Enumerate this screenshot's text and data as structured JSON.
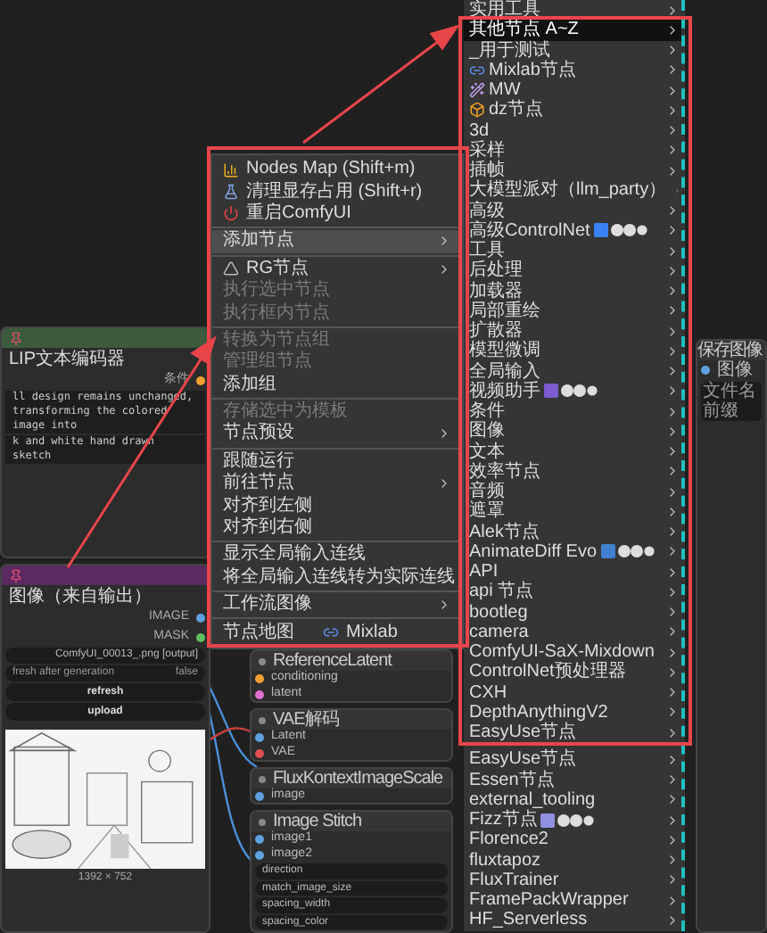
{
  "canvas_nodes": [
    {
      "color": "#3d5a3d",
      "pinned": true,
      "title": "LIP文本编码器",
      "rows": [
        {
          "kind": "output",
          "label": "条件",
          "color": "#f0a030"
        },
        {
          "kind": "text",
          "label": "ll design remains unchanged, transforming the colored image into"
        },
        {
          "kind": "text",
          "label": "k and white hand drawn sketch"
        }
      ]
    },
    {
      "color": "#5a2a60",
      "pinned": true,
      "title": "图像（来自输出）",
      "rows": [
        {
          "kind": "output",
          "label": "IMAGE",
          "color": "#60a0e0"
        },
        {
          "kind": "output",
          "label": "MASK",
          "color": "#60c060"
        },
        {
          "kind": "widget",
          "label": "",
          "value": "ComfyUI_00013_.png [output]"
        },
        {
          "kind": "toggle",
          "label": "fresh after generation",
          "value": "false"
        },
        {
          "kind": "button",
          "label": "refresh"
        },
        {
          "kind": "button",
          "label": "upload"
        },
        {
          "kind": "picture"
        },
        {
          "kind": "caption",
          "label": "1392 × 752"
        }
      ]
    },
    {
      "color": "#353535",
      "pinned": false,
      "title": "ReferenceLatent",
      "rows": [
        {
          "kind": "input",
          "label": "conditioning",
          "color": "#f0a030"
        },
        {
          "kind": "input",
          "label": "latent",
          "color": "#e070d0"
        }
      ]
    },
    {
      "color": "#353535",
      "pinned": false,
      "title": "VAE解码",
      "rows": [
        {
          "kind": "input",
          "label": "Latent",
          "color": "#60a0e0"
        },
        {
          "kind": "input",
          "label": "VAE",
          "color": "#e05050"
        }
      ]
    },
    {
      "color": "#353535",
      "pinned": false,
      "title": "FluxKontextImageScale",
      "rows": [
        {
          "kind": "input",
          "label": "image",
          "color": "#60a0e0"
        }
      ]
    },
    {
      "color": "#353535",
      "pinned": false,
      "title": "Image Stitch",
      "rows": [
        {
          "kind": "input",
          "label": "image1",
          "color": "#60a0e0"
        },
        {
          "kind": "input",
          "label": "image2",
          "color": "#60a0e0"
        },
        {
          "kind": "widget",
          "label": "direction",
          "value": ""
        },
        {
          "kind": "widget",
          "label": "match_image_size",
          "value": ""
        },
        {
          "kind": "widget",
          "label": "spacing_width",
          "value": ""
        },
        {
          "kind": "widget",
          "label": "spacing_color",
          "value": ""
        }
      ]
    },
    {
      "color": "#353535",
      "pinned": false,
      "title": "保存图像",
      "rows": [
        {
          "kind": "input",
          "label": "图像",
          "color": "#60a0e0"
        },
        {
          "kind": "field",
          "label": "文件名前缀"
        }
      ]
    }
  ],
  "context_menu": {
    "groups": [
      [
        {
          "label": "Nodes Map (Shift+m)",
          "kind": "with-icon",
          "disabled": false,
          "selected": false,
          "submenu": false
        },
        {
          "label": "清理显存占用 (Shift+r)",
          "kind": "with-icon",
          "disabled": false,
          "selected": false,
          "submenu": false
        },
        {
          "label": "重启ComfyUI",
          "kind": "with-icon",
          "disabled": false,
          "selected": false,
          "submenu": false
        }
      ],
      [
        {
          "label": "添加节点",
          "kind": "plain",
          "disabled": false,
          "selected": true,
          "submenu": true
        }
      ],
      [
        {
          "label": "RG节点",
          "kind": "with-icon",
          "disabled": false,
          "selected": false,
          "submenu": true
        },
        {
          "label": "执行选中节点",
          "kind": "plain",
          "disabled": true,
          "selected": false,
          "submenu": false
        },
        {
          "label": "执行框内节点",
          "kind": "plain",
          "disabled": true,
          "selected": false,
          "submenu": false
        }
      ],
      [
        {
          "label": "转换为节点组",
          "kind": "plain",
          "disabled": true,
          "selected": false,
          "submenu": false
        },
        {
          "label": "管理组节点",
          "kind": "plain",
          "disabled": true,
          "selected": false,
          "submenu": false
        },
        {
          "label": "添加组",
          "kind": "plain",
          "disabled": false,
          "selected": false,
          "submenu": false
        }
      ],
      [
        {
          "label": "存储选中为模板",
          "kind": "plain",
          "disabled": true,
          "selected": false,
          "submenu": false
        },
        {
          "label": "节点预设",
          "kind": "plain",
          "disabled": false,
          "selected": false,
          "submenu": true
        }
      ],
      [
        {
          "label": "跟随运行",
          "kind": "plain",
          "disabled": false,
          "selected": false,
          "submenu": false
        },
        {
          "label": "前往节点",
          "kind": "plain",
          "disabled": false,
          "selected": false,
          "submenu": true
        },
        {
          "label": "对齐到左侧",
          "kind": "plain",
          "disabled": false,
          "selected": false,
          "submenu": false
        },
        {
          "label": "对齐到右侧",
          "kind": "plain",
          "disabled": false,
          "selected": false,
          "submenu": false
        }
      ],
      [
        {
          "label": "显示全局输入连线",
          "kind": "plain",
          "disabled": false,
          "selected": false,
          "submenu": false
        },
        {
          "label": "将全局输入连线转为实际连线",
          "kind": "plain",
          "disabled": false,
          "selected": false,
          "submenu": false
        }
      ],
      [
        {
          "label": "工作流图像",
          "kind": "plain",
          "disabled": false,
          "selected": false,
          "submenu": true
        }
      ],
      [
        {
          "label": "节点地图",
          "kind": "plain",
          "disabled": false,
          "selected": false,
          "submenu": false
        },
        {
          "label": "Mixlab",
          "kind": "with-icon",
          "disabled": false,
          "selected": false,
          "submenu": false
        }
      ]
    ]
  },
  "submenu": {
    "items": [
      {
        "label": "实用工具",
        "kind": "plain",
        "selected": false
      },
      {
        "label": "其他节点 A~Z",
        "kind": "plain",
        "selected": true
      },
      {
        "label": "_用于测试",
        "kind": "plain",
        "selected": false
      },
      {
        "label": "Mixlab节点",
        "kind": "with-icon",
        "selected": false
      },
      {
        "label": "MW",
        "kind": "with-icon",
        "selected": false
      },
      {
        "label": "dz节点",
        "kind": "with-icon",
        "selected": false
      },
      {
        "label": "3d",
        "kind": "plain",
        "selected": false
      },
      {
        "label": "采样",
        "kind": "plain",
        "selected": false
      },
      {
        "label": "插帧",
        "kind": "plain",
        "selected": false
      },
      {
        "label": "大模型派对（llm_party）",
        "kind": "plain",
        "selected": false
      },
      {
        "label": "高级",
        "kind": "plain",
        "selected": false
      },
      {
        "label": "高级ControlNet",
        "kind": "with-badges",
        "selected": false
      },
      {
        "label": "工具",
        "kind": "plain",
        "selected": false
      },
      {
        "label": "后处理",
        "kind": "plain",
        "selected": false
      },
      {
        "label": "加载器",
        "kind": "plain",
        "selected": false
      },
      {
        "label": "局部重绘",
        "kind": "plain",
        "selected": false
      },
      {
        "label": "扩散器",
        "kind": "plain",
        "selected": false
      },
      {
        "label": "模型微调",
        "kind": "plain",
        "selected": false
      },
      {
        "label": "全局输入",
        "kind": "plain",
        "selected": false
      },
      {
        "label": "视频助手",
        "kind": "with-badges",
        "selected": false
      },
      {
        "label": "条件",
        "kind": "plain",
        "selected": false
      },
      {
        "label": "图像",
        "kind": "plain",
        "selected": false
      },
      {
        "label": "文本",
        "kind": "plain",
        "selected": false
      },
      {
        "label": "效率节点",
        "kind": "plain",
        "selected": false
      },
      {
        "label": "音频",
        "kind": "plain",
        "selected": false
      },
      {
        "label": "遮罩",
        "kind": "plain",
        "selected": false
      },
      {
        "label": "Alek节点",
        "kind": "plain",
        "selected": false
      },
      {
        "label": "AnimateDiff Evo",
        "kind": "with-badges",
        "selected": false
      },
      {
        "label": "API",
        "kind": "plain",
        "selected": false
      },
      {
        "label": "api 节点",
        "kind": "plain",
        "selected": false
      },
      {
        "label": "bootleg",
        "kind": "plain",
        "selected": false
      },
      {
        "label": "camera",
        "kind": "plain",
        "selected": false
      },
      {
        "label": "ComfyUI-SaX-Mixdown",
        "kind": "plain",
        "selected": false
      },
      {
        "label": "ControlNet预处理器",
        "kind": "plain",
        "selected": false
      },
      {
        "label": "CXH",
        "kind": "plain",
        "selected": false
      },
      {
        "label": "DepthAnythingV2",
        "kind": "plain",
        "selected": false
      },
      {
        "label": "EasyUse节点",
        "kind": "plain",
        "selected": false
      },
      {
        "label": "EasyUse节点",
        "kind": "plain",
        "selected": false
      },
      {
        "label": "Essen节点",
        "kind": "plain",
        "selected": false
      },
      {
        "label": "external_tooling",
        "kind": "plain",
        "selected": false
      },
      {
        "label": "Fizz节点",
        "kind": "with-badges",
        "selected": false
      },
      {
        "label": "Florence2",
        "kind": "plain",
        "selected": false
      },
      {
        "label": "fluxtapoz",
        "kind": "plain",
        "selected": false
      },
      {
        "label": "FluxTrainer",
        "kind": "plain",
        "selected": false
      },
      {
        "label": "FramePackWrapper",
        "kind": "plain",
        "selected": false
      },
      {
        "label": "HF_Serverless",
        "kind": "plain",
        "selected": false
      }
    ]
  }
}
